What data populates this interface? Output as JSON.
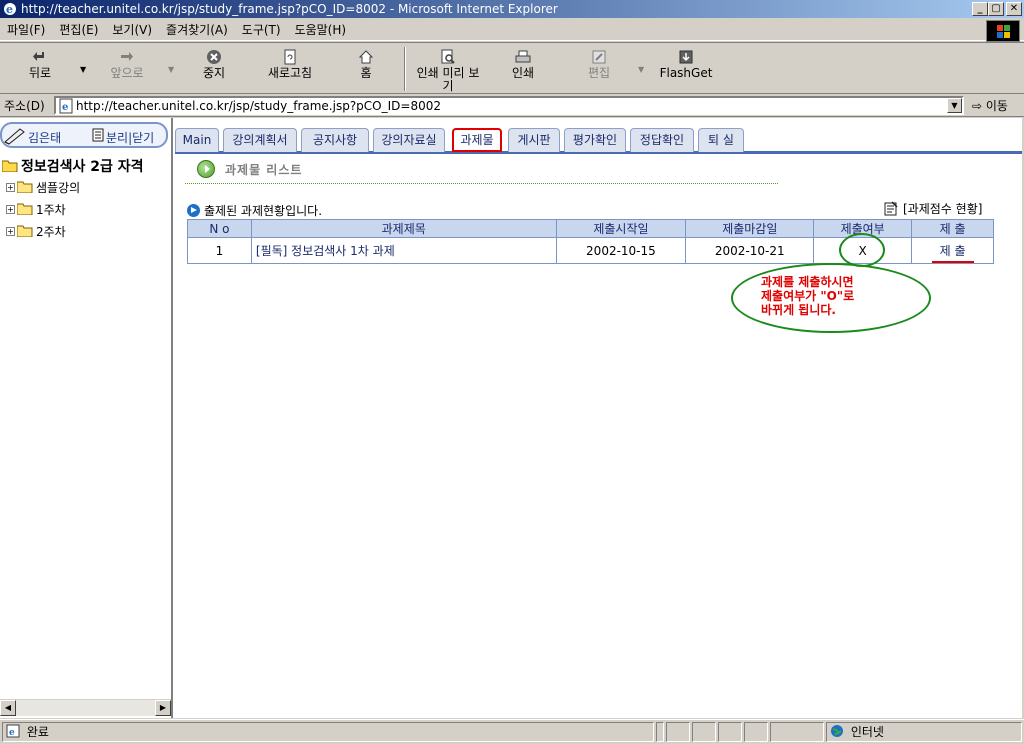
{
  "window": {
    "title": "http://teacher.unitel.co.kr/jsp/study_frame.jsp?pCO_ID=8002 - Microsoft Internet Explorer",
    "min": "_",
    "max": "▢",
    "close": "✕"
  },
  "menu": [
    "파일(F)",
    "편집(E)",
    "보기(V)",
    "즐겨찾기(A)",
    "도구(T)",
    "도움말(H)"
  ],
  "toolbar": {
    "back": "뒤로",
    "forward": "앞으로",
    "stop": "중지",
    "refresh": "새로고침",
    "home": "홈",
    "print_preview": "인쇄 미리 보기",
    "print": "인쇄",
    "edit": "편집",
    "flashget": "FlashGet"
  },
  "address": {
    "label": "주소(D)",
    "url": "http://teacher.unitel.co.kr/jsp/study_frame.jsp?pCO_ID=8002",
    "go": "이동"
  },
  "left": {
    "user_name": "김은태",
    "controls": "분리|닫기",
    "course": "정보검색사 2급 자격",
    "nodes": [
      "샘플강의",
      "1주차",
      "2주차"
    ]
  },
  "tabs": [
    "Main",
    "강의계획서",
    "공지사항",
    "강의자료실",
    "과제물",
    "게시판",
    "평가확인",
    "정답확인",
    "퇴 실"
  ],
  "active_tab": "과제물",
  "section": {
    "title": "과제물 리스트",
    "subtitle": "출제된 과제현황입니다.",
    "score_link": "[과제점수 현황]"
  },
  "table": {
    "headers": [
      "N o",
      "과제제목",
      "제출시작일",
      "제출마감일",
      "제출여부",
      "제 출"
    ],
    "rows": [
      {
        "no": "1",
        "title": "[필독] 정보검색사 1차 과제",
        "start": "2002-10-15",
        "end": "2002-10-21",
        "status": "X",
        "action": "제 출"
      }
    ]
  },
  "annotation": {
    "line1": "과제를  제출하시면",
    "line2": "제출여부가  \"O\"로",
    "line3": "바뀌게  됩니다."
  },
  "statusbar": {
    "left": "완료",
    "zone": "인터넷"
  },
  "colors": {
    "tab_bg": "#dde3ef",
    "tab_text": "#1a2a6c",
    "active_tab_border": "#e00000",
    "annotation": "#1a8a1a",
    "annotation_text": "#e00000"
  }
}
